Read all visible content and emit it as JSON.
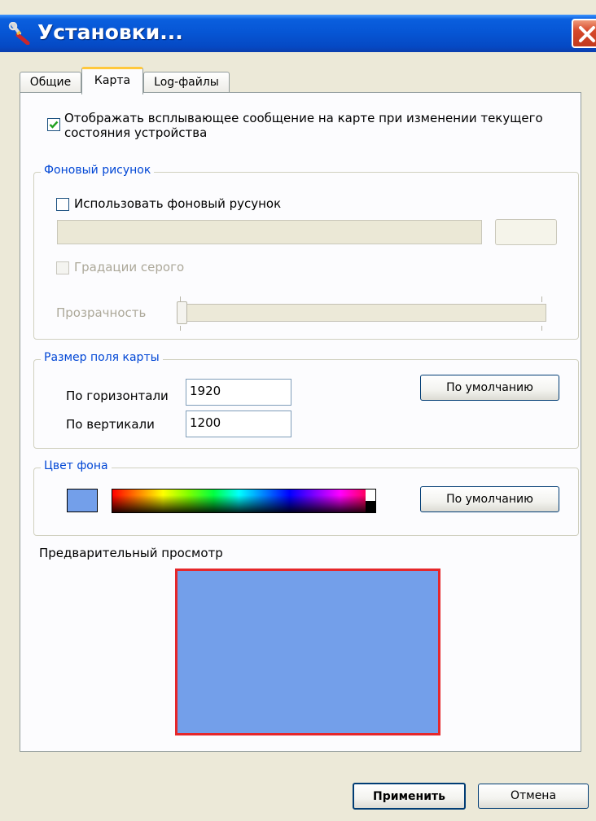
{
  "window": {
    "title": "Установки...",
    "close": "×"
  },
  "tabs": [
    {
      "label": "Общие"
    },
    {
      "label": "Карта"
    },
    {
      "label": "Log-файлы"
    }
  ],
  "map_tab": {
    "popup_checkbox": {
      "line1": "Отображать всплывающее сообщение на карте при изменении текущего",
      "line2": "состояния устройства",
      "checked": true
    },
    "background_image": {
      "legend": "Фоновый рисунок",
      "use_checkbox_label": "Использовать фоновый русунок",
      "path_value": "",
      "browse_label": "",
      "grayscale_label": "Градации серого",
      "transparency_label": "Прозрачность",
      "transparency_value": 0
    },
    "map_size": {
      "legend": "Размер поля карты",
      "horizontal_label": "По горизонтали",
      "horizontal_value": "1920",
      "vertical_label": "По вертикали",
      "vertical_value": "1200",
      "default_button": "По умолчанию"
    },
    "background_color": {
      "legend": "Цвет фона",
      "swatch_color": "#739fea",
      "default_button": "По умолчанию"
    },
    "preview": {
      "label": "Предварительный просмотр",
      "fill_color": "#739fea",
      "border_color": "#e5272a"
    }
  },
  "footer": {
    "apply_button": "Применить",
    "cancel_button": "Отмена"
  },
  "colors": {
    "titlebar": "#0655d4",
    "dialog_bg": "#ece9d8",
    "tab_accent": "#ffc83c",
    "groupbox_legend": "#0046d5",
    "close_button": "#d6482a",
    "check_mark": "#21a121"
  }
}
